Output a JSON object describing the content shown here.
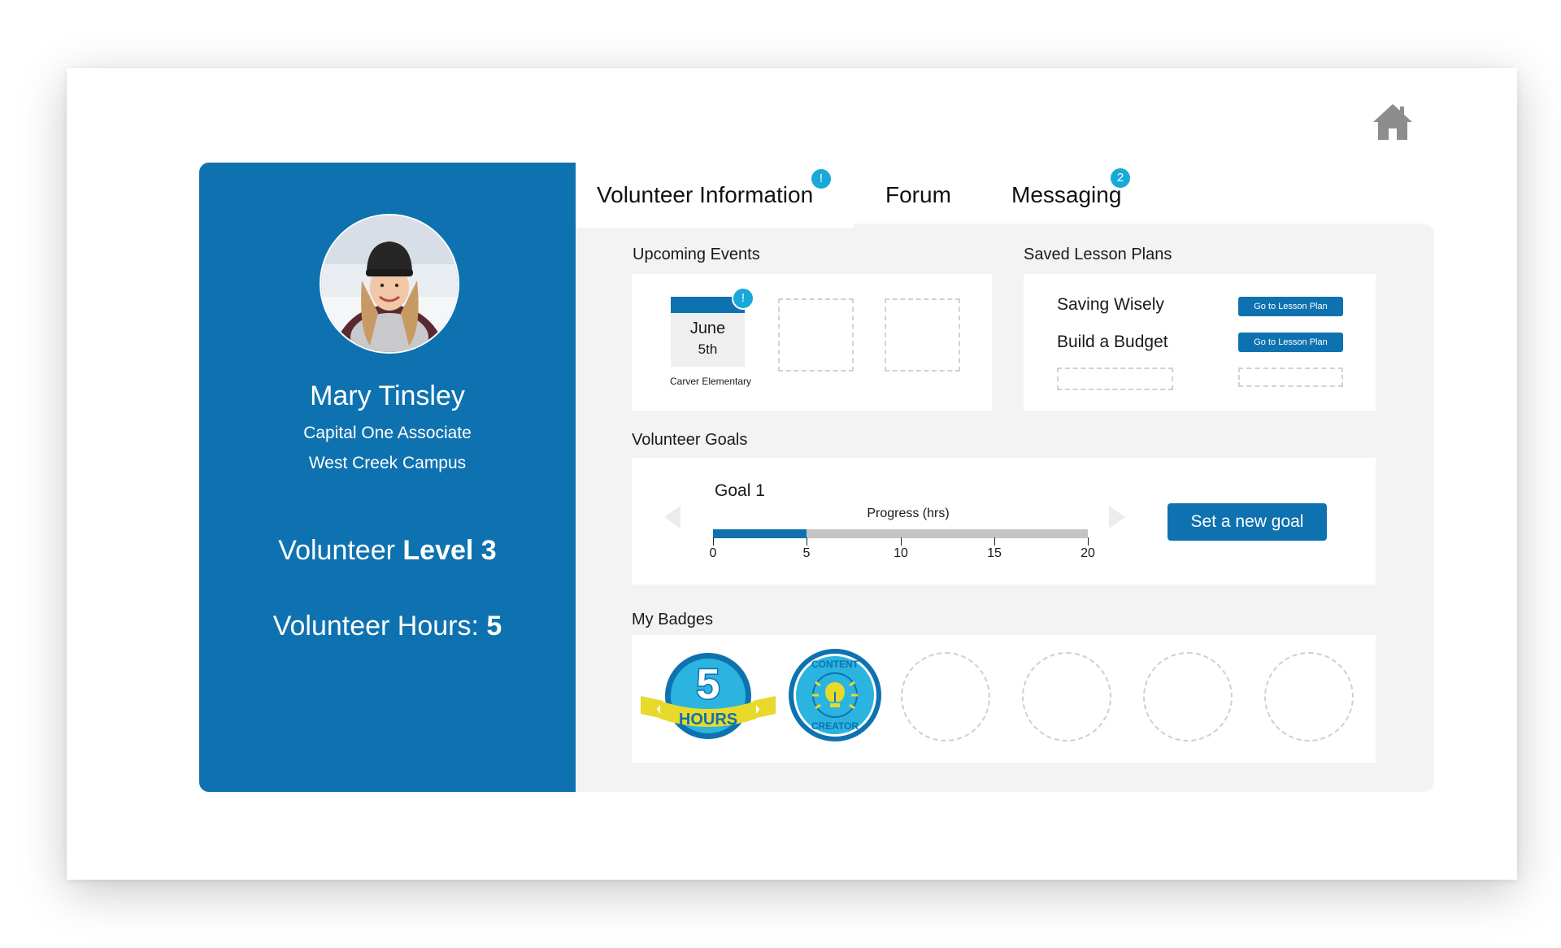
{
  "profile": {
    "name": "Mary Tinsley",
    "role": "Capital One Associate",
    "campus": "West Creek Campus",
    "level_prefix": "Volunteer ",
    "level_value": "Level 3",
    "hours_prefix": "Volunteer Hours: ",
    "hours_value": "5"
  },
  "tabs": [
    {
      "label": "Volunteer Information",
      "badge": "!",
      "active": true
    },
    {
      "label": "Forum",
      "badge": "",
      "active": false
    },
    {
      "label": "Messaging",
      "badge": "2",
      "active": false
    }
  ],
  "sections": {
    "upcoming_events": "Upcoming Events",
    "saved_lessons": "Saved Lesson Plans",
    "volunteer_goals": "Volunteer Goals",
    "my_badges": "My Badges"
  },
  "event": {
    "month": "June",
    "day": "5th",
    "location": "Carver Elementary",
    "alert": "!"
  },
  "lessons": [
    {
      "title": "Saving Wisely",
      "button": "Go to Lesson Plan"
    },
    {
      "title": "Build a Budget",
      "button": "Go to Lesson Plan"
    }
  ],
  "goal": {
    "name": "Goal 1",
    "progress_label": "Progress (hrs)",
    "progress_value": 5,
    "progress_max": 20,
    "ticks": [
      "0",
      "5",
      "10",
      "15",
      "20"
    ],
    "button": "Set a new goal"
  },
  "badges": {
    "hours_badge_number": "5",
    "hours_badge_text": "HOURS",
    "creator_badge_top": "CONTENT",
    "creator_badge_bottom": "CREATOR"
  },
  "colors": {
    "primary_blue": "#0f72b0",
    "notification_cyan": "#19a9d8",
    "badge_yellow": "#e8d92b",
    "badge_cyan": "#2ab4df"
  },
  "icons": {
    "home": "home-icon"
  }
}
